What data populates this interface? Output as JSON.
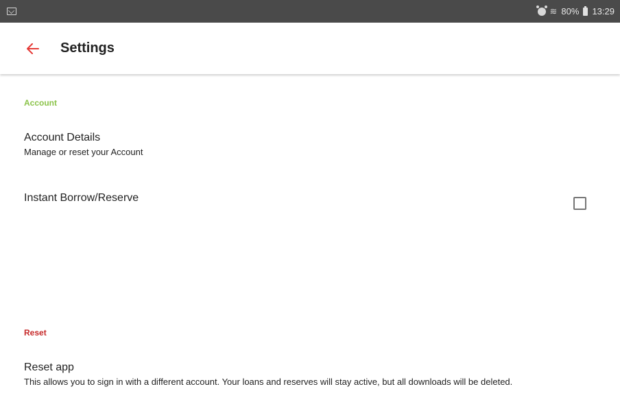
{
  "status_bar": {
    "battery": "80%",
    "time": "13:29",
    "icons": [
      "mail-icon",
      "alarm-icon",
      "wifi-icon",
      "battery-icon"
    ]
  },
  "app_bar": {
    "title": "Settings",
    "back_icon": "arrow-left-icon",
    "accent_color": "#e53935"
  },
  "sections": {
    "account": {
      "header": "Account",
      "header_color": "#8bc34a",
      "items": [
        {
          "title": "Account Details",
          "subtitle": "Manage or reset your Account"
        },
        {
          "title": "Instant Borrow/Reserve",
          "subtitle": "",
          "checkbox_checked": false
        }
      ]
    },
    "reset": {
      "header": "Reset",
      "header_color": "#c62828",
      "items": [
        {
          "title": "Reset app",
          "subtitle": "This allows you to sign in with a different account. Your loans and reserves will stay active, but all downloads will be deleted."
        }
      ]
    }
  }
}
